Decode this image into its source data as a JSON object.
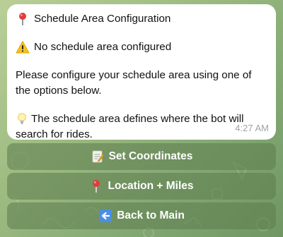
{
  "message": {
    "title": "Schedule Area Configuration",
    "warning": "No schedule area configured",
    "instruction": "Please configure your schedule area using one of the options below.",
    "hint": "The schedule area defines where the bot will search for rides.",
    "time": "4:27 AM"
  },
  "keyboard": {
    "set_coordinates": "Set Coordinates",
    "location_miles": "Location + Miles",
    "back_to_main": "Back to Main"
  },
  "icons": {
    "title": "pushpin-icon",
    "warning": "warning-icon",
    "hint": "lightbulb-icon",
    "set_coordinates": "memo-icon",
    "location_miles": "pushpin-icon",
    "back_to_main": "back-arrow-icon"
  },
  "colors": {
    "bubble_bg": "#ffffff",
    "timestamp": "#9aa7a0",
    "button_bg": "#6f8f5e",
    "button_text": "#ffffff"
  }
}
